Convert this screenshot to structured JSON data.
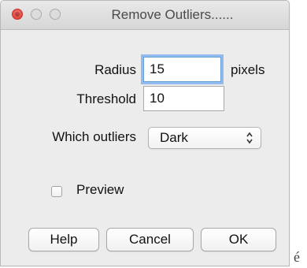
{
  "window": {
    "title": "Remove Outliers......"
  },
  "form": {
    "radius_label": "Radius",
    "radius_value": "15",
    "radius_unit": "pixels",
    "threshold_label": "Threshold",
    "threshold_value": "10",
    "which_label": "Which outliers",
    "which_value": "Dark",
    "preview_label": "Preview",
    "preview_checked": false
  },
  "buttons": {
    "help": "Help",
    "cancel": "Cancel",
    "ok": "OK"
  },
  "background": {
    "edge_text": "é"
  },
  "icons": {
    "close": "close-icon",
    "minimize": "minimize-icon",
    "maximize": "maximize-icon",
    "select_arrows": "up-down-arrows-icon"
  },
  "colors": {
    "window_bg": "#ececec",
    "close_button": "#e0443b",
    "focus_ring": "#8fbcef"
  }
}
